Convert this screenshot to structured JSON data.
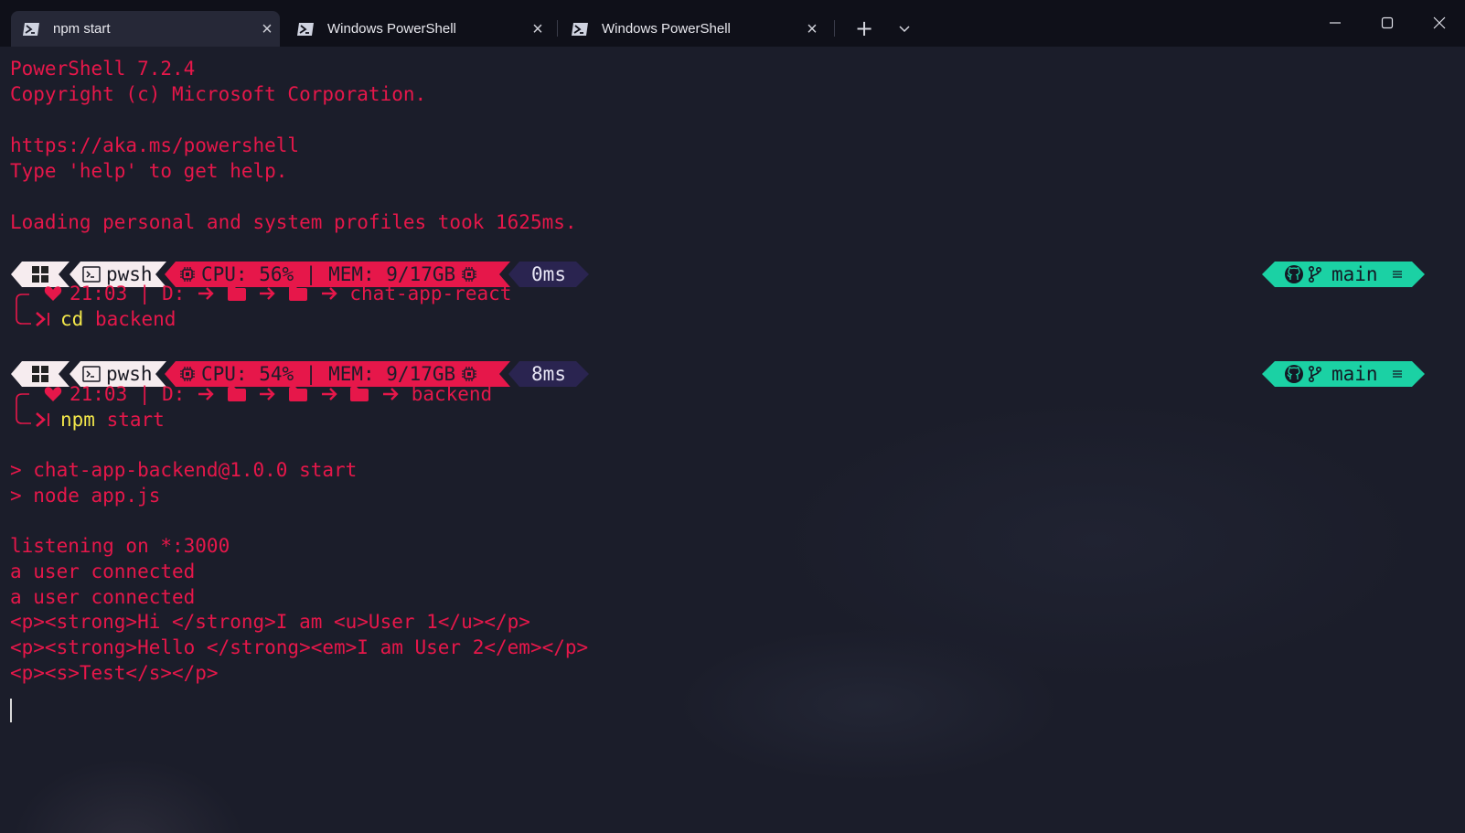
{
  "window": {
    "tabs": [
      {
        "label": "npm start",
        "active": true
      },
      {
        "label": "Windows PowerShell",
        "active": false
      },
      {
        "label": "Windows PowerShell",
        "active": false
      }
    ],
    "new_tab_glyph": "+",
    "dropdown_glyph": "⌄",
    "colors": {
      "titlebar": "#0f1019",
      "active_tab": "#262837",
      "terminal_bg": "#1b1d2a"
    }
  },
  "terminal": {
    "colors": {
      "text": "#e6174a",
      "command": "#f2e64a",
      "git_segment": "#1bd1a4",
      "time_segment": "#2a2450",
      "shell_segment": "#f6ecef"
    },
    "intro": [
      "PowerShell 7.2.4",
      "Copyright (c) Microsoft Corporation.",
      "",
      "https://aka.ms/powershell",
      "Type 'help' to get help.",
      "",
      "Loading personal and system profiles took 1625ms."
    ],
    "prompts": [
      {
        "shell": "pwsh",
        "sys": "CPU: 56% | MEM: 9/17GB",
        "exec_time": "0ms",
        "git_branch": "main",
        "clock": "21:03",
        "drive": "D:",
        "folder_count": 2,
        "cwd": "chat-app-react",
        "cmd_name": "cd",
        "cmd_args": "backend"
      },
      {
        "shell": "pwsh",
        "sys": "CPU: 54% | MEM: 9/17GB",
        "exec_time": "8ms",
        "git_branch": "main",
        "clock": "21:03",
        "drive": "D:",
        "folder_count": 3,
        "cwd": "backend",
        "cmd_name": "npm",
        "cmd_args": "start"
      }
    ],
    "output": [
      "> chat-app-backend@1.0.0 start",
      "> node app.js",
      "",
      "listening on *:3000",
      "a user connected",
      "a user connected",
      "<p><strong>Hi </strong>I am <u>User 1</u></p>",
      "<p><strong>Hello </strong><em>I am User 2</em></p>",
      "<p><s>Test</s></p>"
    ]
  }
}
